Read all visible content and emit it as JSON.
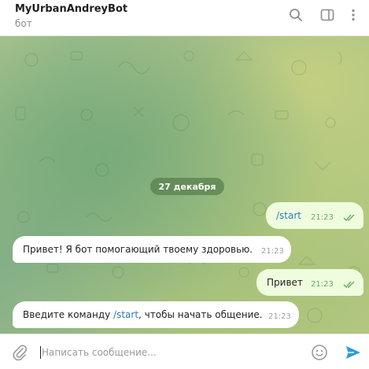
{
  "header": {
    "title": "MyUrbanAndreyBot",
    "subtitle": "бот",
    "icons": [
      "search-icon",
      "sidebar-toggle-icon",
      "more-icon"
    ]
  },
  "chat": {
    "date_label": "27 декабря",
    "messages": [
      {
        "direction": "out",
        "text": "/start",
        "time": "21:23",
        "read": true
      },
      {
        "direction": "in",
        "text": "Привет! Я бот помогающий твоему здоровью.",
        "time": "21:23"
      },
      {
        "direction": "out",
        "text": "Привет",
        "time": "21:23",
        "read": true
      },
      {
        "direction": "in",
        "text_before": "Введите команду ",
        "link": "/start",
        "text_after": ", чтобы начать общение.",
        "time": "21:23"
      }
    ]
  },
  "composer": {
    "placeholder": "Написать сообщение...",
    "value": "",
    "icons": [
      "paperclip-icon",
      "emoji-icon",
      "send-icon"
    ]
  },
  "colors": {
    "incoming_bubble": "#ffffff",
    "outgoing_bubble": "#effdde",
    "accent": "#2b9be0",
    "read_checks": "#6aaa64",
    "date_pill": "#58804e"
  }
}
